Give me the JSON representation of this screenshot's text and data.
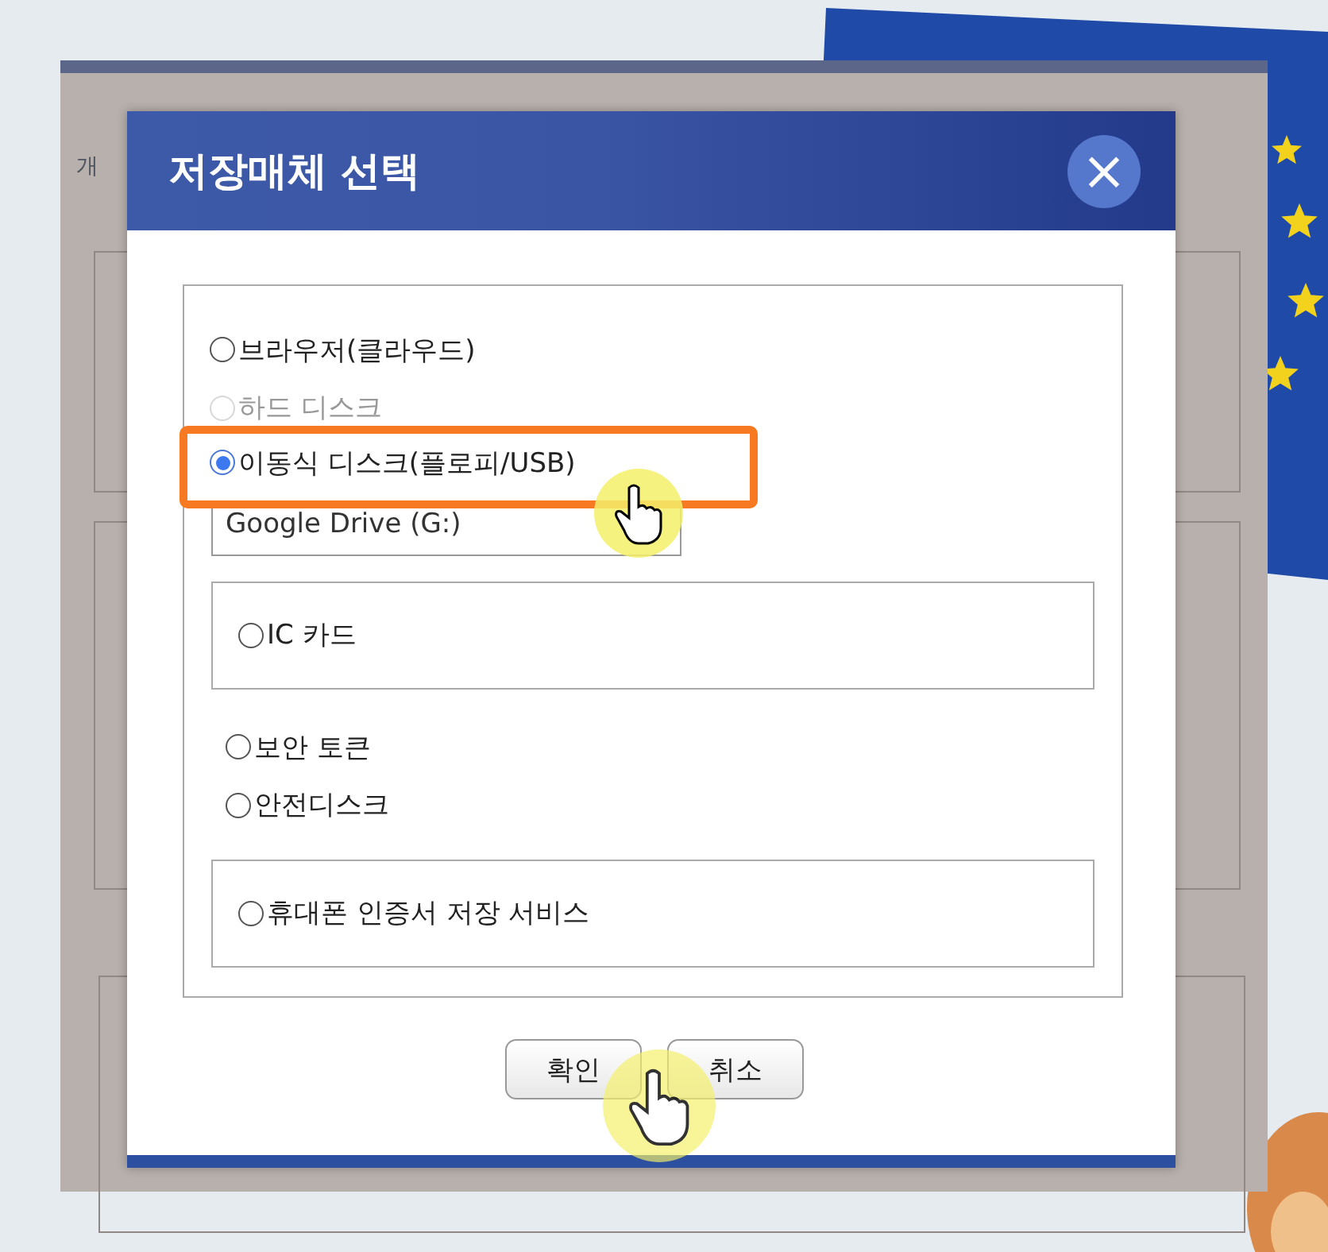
{
  "backdrop_window": {
    "tab": "개"
  },
  "dialog": {
    "title": "저장매체 선택",
    "close": "×"
  },
  "options": [
    {
      "kind": "plain",
      "label": "브라우저(클라우드)",
      "selected": false,
      "disabled": false
    },
    {
      "kind": "plain",
      "label": "하드 디스크",
      "selected": false,
      "disabled": true
    },
    {
      "kind": "plain",
      "label": "이동식 디스크(플로피/USB)",
      "selected": true,
      "disabled": false,
      "highlighted": true,
      "drive": "Google Drive (G:)"
    },
    {
      "kind": "boxed",
      "label": "IC 카드",
      "selected": false,
      "disabled": false
    },
    {
      "kind": "plain",
      "label": "보안 토큰",
      "selected": false,
      "disabled": false
    },
    {
      "kind": "plain",
      "label": "안전디스크",
      "selected": false,
      "disabled": false
    },
    {
      "kind": "boxed",
      "label": "휴대폰 인증서 저장 서비스",
      "selected": false,
      "disabled": false
    }
  ],
  "buttons": [
    "확인",
    "취소"
  ]
}
